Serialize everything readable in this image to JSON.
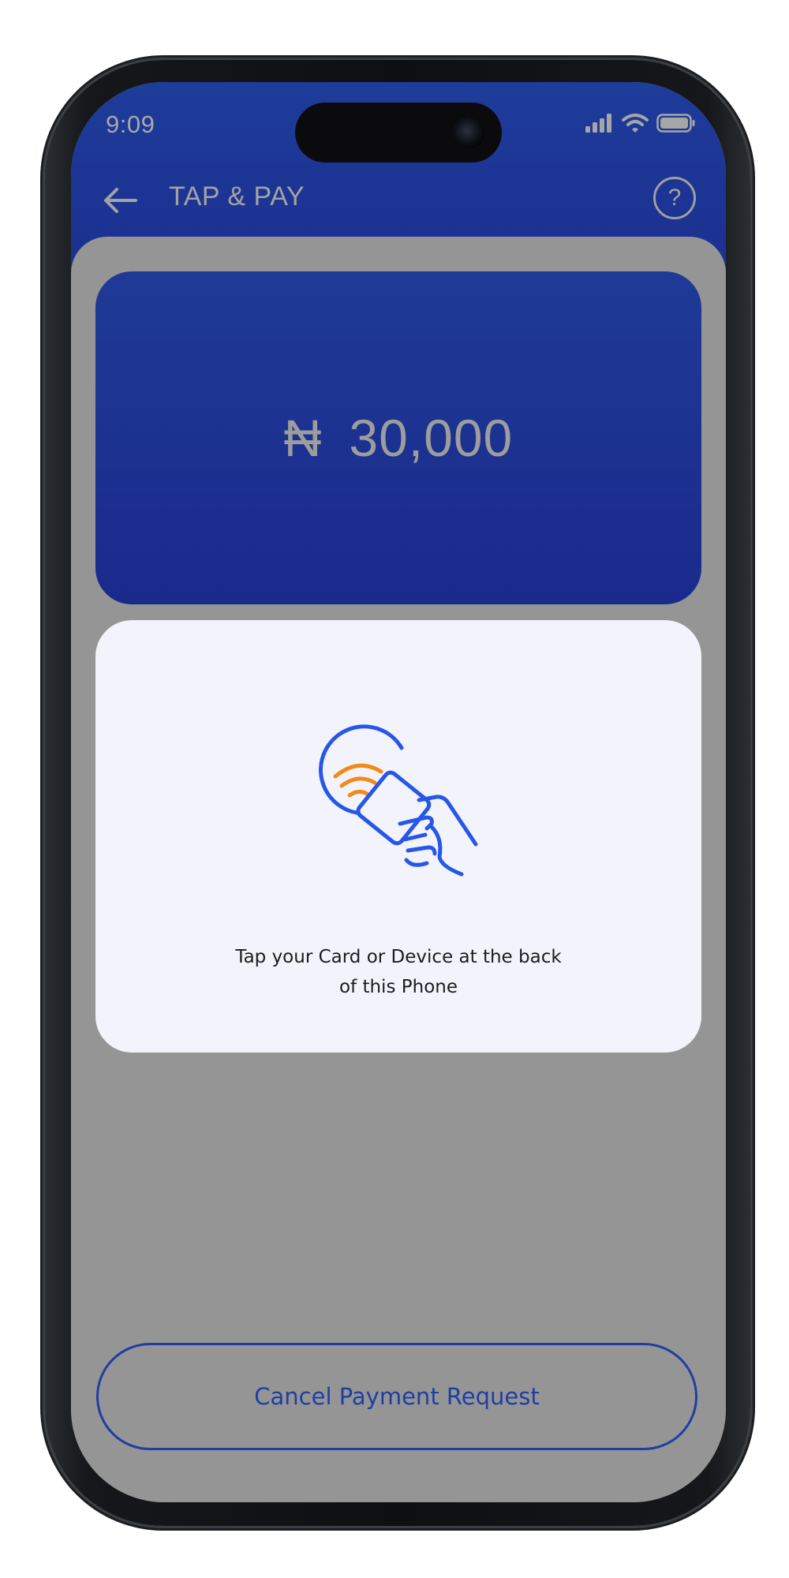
{
  "status_bar": {
    "time": "9:09",
    "icons": [
      "signal-icon",
      "wifi-icon",
      "battery-icon"
    ]
  },
  "header": {
    "back_icon": "back-arrow-icon",
    "title": "TAP & PAY",
    "help_label": "?"
  },
  "amount": {
    "currency_symbol": "₦",
    "value": "30,000"
  },
  "tap_prompt": {
    "icon": "nfc-tap-card-icon",
    "line1": "Tap your Card or Device at the back",
    "line2": "of this Phone"
  },
  "actions": {
    "cancel_label": "Cancel Payment Request"
  },
  "colors": {
    "brand_blue": "#1e3a96",
    "nfc_orange": "#f28a1a",
    "nfc_blue": "#2757e6",
    "overlay_gray": "#959595"
  }
}
